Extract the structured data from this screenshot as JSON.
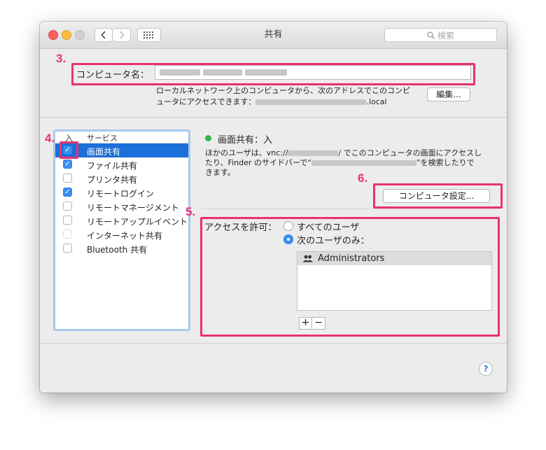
{
  "window": {
    "title": "共有",
    "search_placeholder": "検索",
    "back_icon": "chevron-left-icon",
    "forward_icon": "chevron-right-icon",
    "grid_icon": "grid-icon"
  },
  "computer_name": {
    "label": "コンピュータ名：",
    "value": "",
    "desc_line1": "ローカルネットワーク上のコンピュータから、次のアドレスでこのコンピ",
    "desc_line2_prefix": "ュータにアクセスできます：",
    "desc_line2_suffix": ".local",
    "edit_button": "編集..."
  },
  "services": {
    "header_on": "入",
    "header_service": "サービス",
    "items": [
      {
        "label": "画面共有",
        "checked": true,
        "selected": true
      },
      {
        "label": "ファイル共有",
        "checked": true,
        "selected": false
      },
      {
        "label": "プリンタ共有",
        "checked": false,
        "selected": false
      },
      {
        "label": "リモートログイン",
        "checked": true,
        "selected": false
      },
      {
        "label": "リモートマネージメント",
        "checked": false,
        "selected": false
      },
      {
        "label": "リモートアップルイベント",
        "checked": false,
        "selected": false
      },
      {
        "label": "インターネット共有",
        "checked": false,
        "selected": false
      },
      {
        "label": "Bluetooth 共有",
        "checked": false,
        "selected": false
      }
    ]
  },
  "detail": {
    "status": "画面共有：入",
    "status_color": "#2fb44a",
    "info_a": "ほかのユーザは、vnc://",
    "info_b": "/ でこのコンピュータの画面にアクセスし",
    "info_c": "たり、Finder のサイドバーで“",
    "info_d": "”を検索したりで",
    "info_e": "きます。",
    "computer_settings_button": "コンピュータ設定...",
    "allow_label": "アクセスを許可：",
    "option_all": "すべてのユーザ",
    "option_only": "次のユーザのみ：",
    "users": [
      "Administrators"
    ],
    "add_button": "+",
    "remove_button": "−"
  },
  "help": "?",
  "annotations": {
    "n3": "3.",
    "n4": "4.",
    "n5": "5.",
    "n6": "6.",
    "color": "#e8336f"
  }
}
